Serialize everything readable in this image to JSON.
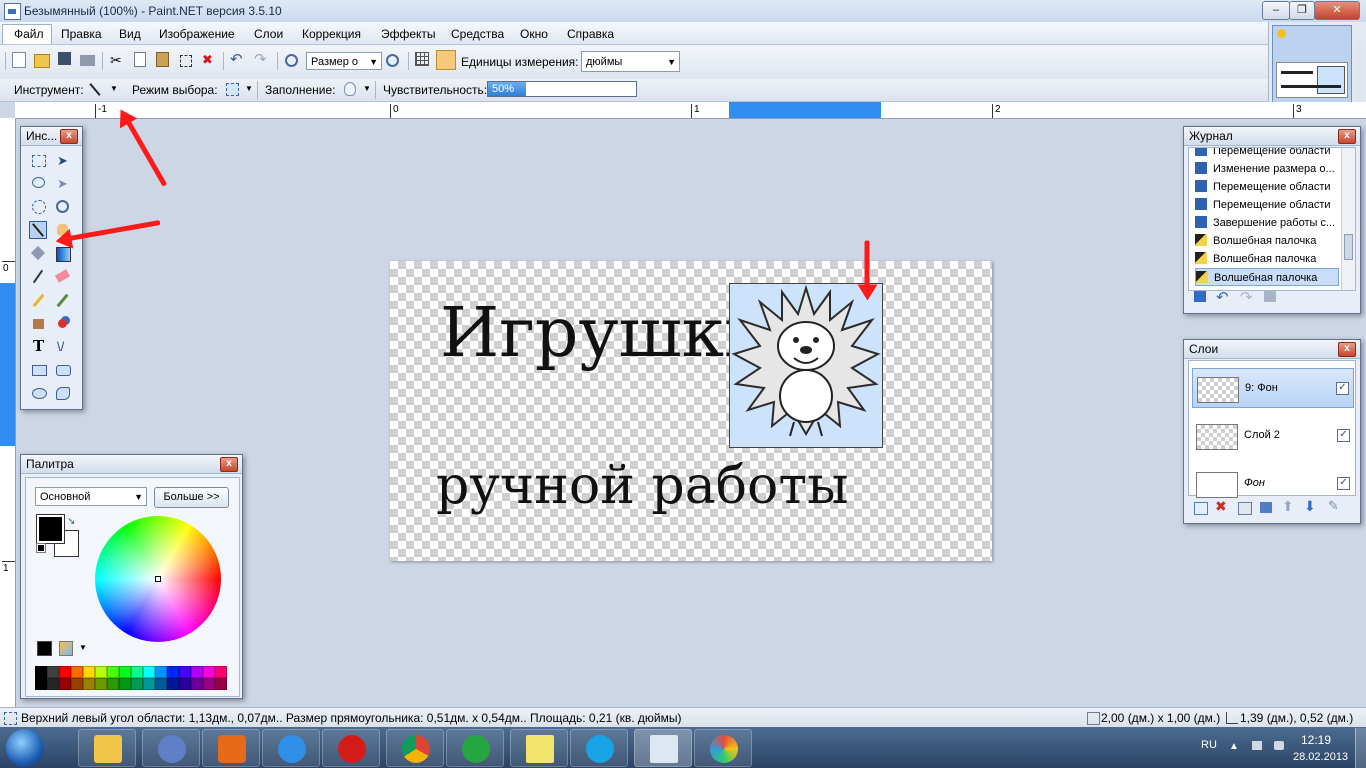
{
  "window": {
    "title": "Безымянный (100%) - Paint.NET версия 3.5.10",
    "minimize": "‒",
    "maximize": "❐",
    "close": "✕"
  },
  "menu": [
    "Файл",
    "Правка",
    "Вид",
    "Изображение",
    "Слои",
    "Коррекция",
    "Эффекты",
    "Средства",
    "Окно",
    "Справка"
  ],
  "toolbar": {
    "zoom_combo": "Размер о",
    "units_label": "Единицы измерения:",
    "units_value": "дюймы"
  },
  "props": {
    "tool_label": "Инструмент:",
    "selection_mode_label": "Режим выбора:",
    "fill_label": "Заполнение:",
    "tolerance_label": "Чувствительность:",
    "tolerance_value": "50%",
    "tolerance_level": 0.5
  },
  "ruler": {
    "h_labels": [
      "-1",
      "0",
      "1",
      "2",
      "3"
    ],
    "v_labels": [
      "0",
      "1"
    ]
  },
  "canvas": {
    "line1": "Игрушки",
    "line2": "ручной работы"
  },
  "tools_panel": {
    "title": "Инс..."
  },
  "history_panel": {
    "title": "Журнал",
    "items": [
      "Перемещение области",
      "Изменение размера о...",
      "Перемещение области",
      "Перемещение области",
      "Завершение работы с...",
      "Волшебная палочка",
      "Волшебная палочка",
      "Волшебная палочка"
    ]
  },
  "layers_panel": {
    "title": "Слои",
    "layers": [
      {
        "name": "9: Фон",
        "checked": "✓"
      },
      {
        "name": "Слой 2",
        "checked": "✓"
      },
      {
        "name": "Фон",
        "checked": "✓"
      }
    ]
  },
  "palette_panel": {
    "title": "Палитра",
    "mode": "Основной",
    "more_button": "Больше >>",
    "colors": [
      "#000000",
      "#404040",
      "#ff0000",
      "#ff6a00",
      "#ffd800",
      "#b6ff00",
      "#4cff00",
      "#00ff21",
      "#00ff90",
      "#00ffff",
      "#0094ff",
      "#0026ff",
      "#4800ff",
      "#b200ff",
      "#ff00dc",
      "#ff006e"
    ]
  },
  "statusbar": {
    "text": "Верхний левый угол области: 1,13дм., 0,07дм.. Размер прямоугольника: 0,51дм. x 0,54дм.. Площадь: 0,21 (кв. дюймы)",
    "size": "2,00 (дм.) x 1,00 (дм.)",
    "cursor": "1,39 (дм.), 0,52 (дм.)"
  },
  "taskbar": {
    "lang": "RU",
    "time": "12:19",
    "date": "28.02.2013"
  },
  "colors": {
    "accent": "#3b6fc4",
    "arrow": "#ff1a1a"
  }
}
